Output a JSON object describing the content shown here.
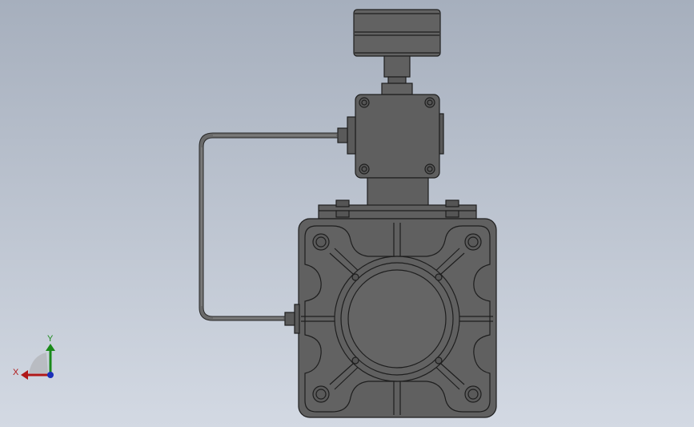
{
  "viewport": {
    "background_top": "#aab3c0",
    "background_bottom": "#d2d8e2"
  },
  "model": {
    "body_color": "#5f5f5f",
    "edge_color": "#1e1e1e",
    "highlight_color": "#7a7a7a"
  },
  "triad": {
    "x_label": "X",
    "y_label": "Y",
    "x_color": "#b01818",
    "y_color": "#1a8a1a",
    "z_color": "#1a2fb8"
  }
}
